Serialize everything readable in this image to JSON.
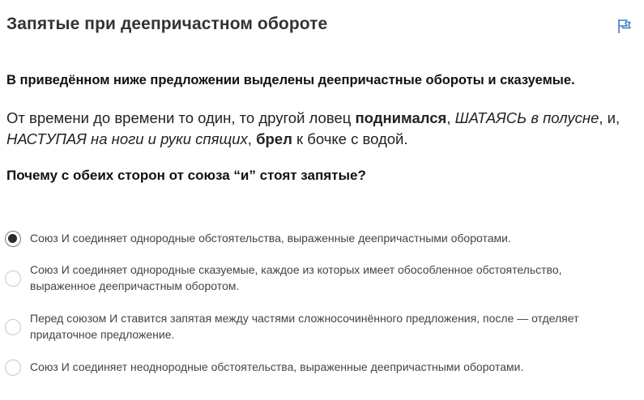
{
  "header": {
    "title": "Запятые при деепричастном обороте",
    "flag_icon": "flag-icon",
    "accent_color": "#3b7fc4"
  },
  "task": {
    "instruction": "В приведённом ниже предложении выделены деепричастные обороты и сказуемые.",
    "sentence": {
      "part1": "От времени до времени то один, то другой ловец ",
      "predicate1": "поднимался",
      "comma1": ", ",
      "adv1_caps": "ШАТАЯСЬ",
      "adv1_rest": " в полусне",
      "part2": ", и,",
      "adv2_caps": "НАСТУПАЯ",
      "adv2_rest": " на ноги и руки спящих",
      "comma2": ", ",
      "predicate2": "брел",
      "part3": " к бочке с водой."
    },
    "question": "Почему с обеих сторон от союза “и” стоят запятые?"
  },
  "options": [
    {
      "label": "Союз И соединяет однородные обстоятельства, выраженные деепричастными оборотами.",
      "selected": true
    },
    {
      "label": "Союз И соединяет однородные сказуемые, каждое из которых имеет обособленное обстоятельство, выраженное деепричастным оборотом.",
      "selected": false
    },
    {
      "label": "Перед союзом И ставится запятая между частями сложносочинённого предложения, после — отделяет придаточное предложение.",
      "selected": false
    },
    {
      "label": "Союз И соединяет неоднородные обстоятельства, выраженные деепричастными оборотами.",
      "selected": false
    }
  ]
}
